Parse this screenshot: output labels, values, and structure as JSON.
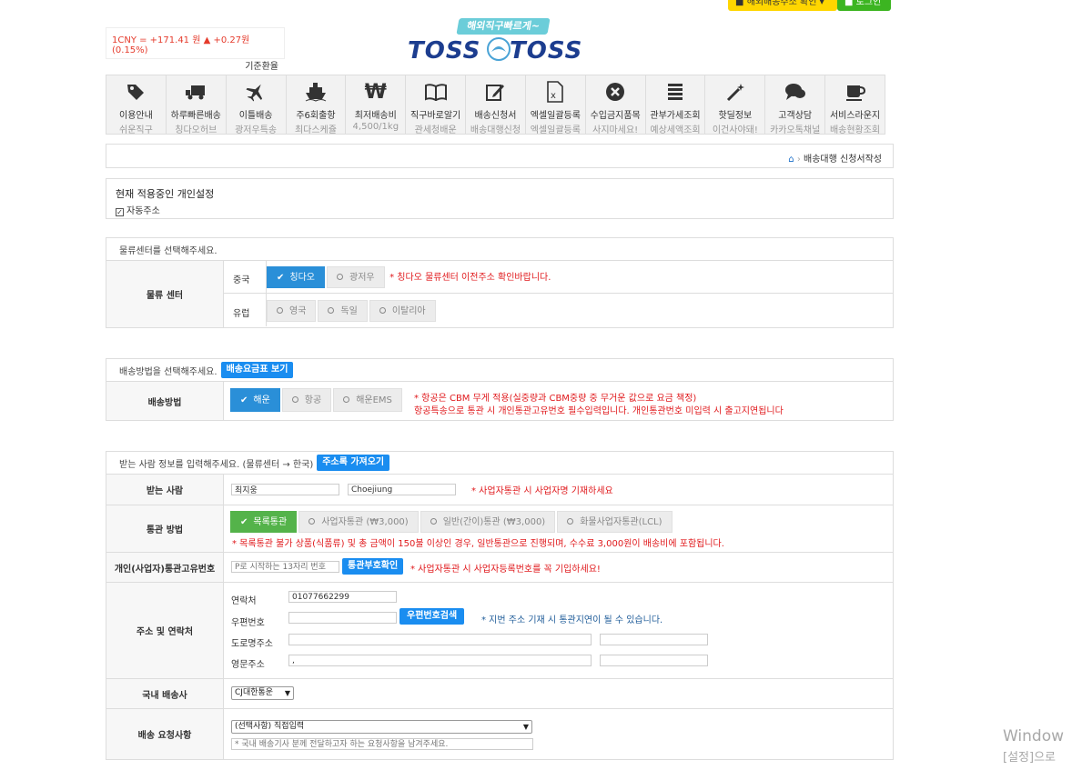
{
  "top_buttons": {
    "customs_check": "■ 해외배송주소 확인 ▾",
    "login": "■ 로그인"
  },
  "currency": {
    "rate": "1CNY = +171.41 원 ▲ +0.27원 (0.15%)",
    "label": "기준환율"
  },
  "logo": {
    "tagline": "해외직구빠르게~",
    "brand": "TOSS TOSS"
  },
  "menu": [
    {
      "icon": "tag-icon",
      "title": "이용안내",
      "sub": "쉬운직구"
    },
    {
      "icon": "truck-icon",
      "title": "하루빠른배송",
      "sub": "칭다오허브"
    },
    {
      "icon": "plane-icon",
      "title": "이틀배송",
      "sub": "광저우특송"
    },
    {
      "icon": "ship-icon",
      "title": "주6회출항",
      "sub": "최다스케쥴"
    },
    {
      "icon": "won-icon",
      "title": "최저배송비",
      "sub": "4,500/1kg"
    },
    {
      "icon": "book-icon",
      "title": "직구바로알기",
      "sub": "관세청배운"
    },
    {
      "icon": "edit-icon",
      "title": "배송신청서",
      "sub": "배송대행신청"
    },
    {
      "icon": "excel-icon",
      "title": "엑셀일괄등록",
      "sub": "엑셀일괄등록"
    },
    {
      "icon": "ban-icon",
      "title": "수입금지품목",
      "sub": "사지마세요!"
    },
    {
      "icon": "list-icon",
      "title": "관부가세조회",
      "sub": "예상세액조회"
    },
    {
      "icon": "magic-icon",
      "title": "핫딜정보",
      "sub": "이건사야돼!"
    },
    {
      "icon": "chat-icon",
      "title": "고객상담",
      "sub": "카카오톡채널"
    },
    {
      "icon": "cup-icon",
      "title": "서비스라운지",
      "sub": "배송현황조회"
    }
  ],
  "breadcrumb": {
    "current": "배송대행 신청서작성"
  },
  "personal": {
    "heading": "현재 적용중인 개인설정",
    "option": "자동주소"
  },
  "center_section": {
    "heading": "물류센터를 선택해주세요.",
    "label": "물류 센터",
    "china_label": "중국",
    "china_options": [
      "칭다오",
      "광저우"
    ],
    "china_note": "* 칭다오 물류센터 이전주소 확인바랍니다.",
    "europe_label": "유럽",
    "europe_options": [
      "영국",
      "독일",
      "이탈리아"
    ]
  },
  "shipping_section": {
    "heading": "배송방법을 선택해주세요.",
    "fee_button": "배송요금표 보기",
    "label": "배송방법",
    "options": [
      "해운",
      "항공",
      "해운EMS"
    ],
    "note1": "* 항공은 CBM 무게 적용(실중량과 CBM중량 중 무거운 값으로 요금 책정)",
    "note2": "항공특송으로 통관 시 개인통관고유번호 필수입력입니다. 개인통관번호 미입력 시 출고지연됩니다"
  },
  "receiver_section": {
    "heading": "받는 사람 정보를 입력해주세요. (물류센터 → 한국)",
    "address_book_button": "주소록 가져오기",
    "receiver_label": "받는 사람",
    "receiver_name": "최지웅",
    "receiver_name_en": "Choejiung",
    "receiver_note": "* 사업자통관 시 사업자명 기재하세요",
    "customs_label": "통관 방법",
    "customs_options": [
      "목록통관",
      "사업자통관 (₩3,000)",
      "일반(간이)통관 (₩3,000)",
      "화물사업자통관(LCL)"
    ],
    "customs_note": "* 목록통관 불가 상품(식품류) 및 총 금액이 150불 이상인 경우, 일반통관으로 진행되며, 수수료 3,000원이 배송비에 포함됩니다.",
    "pccc_label": "개인(사업자)통관고유번호",
    "pccc_placeholder": "P로 시작하는 13자리 번호",
    "pccc_button": "통관부호확인",
    "pccc_note": "* 사업자통관 시 사업자등록번호를 꼭 기입하세요!",
    "address_label": "주소 및 연락처",
    "phone_label": "연락처",
    "phone_value": "01077662299",
    "zip_label": "우편번호",
    "zip_button": "우편번호검색",
    "zip_note": "* 지번 주소 기재 시 통관지연이 될 수 있습니다.",
    "road_label": "도로명주소",
    "eng_label": "영문주소",
    "eng_value": ",",
    "courier_label": "국내 배송사",
    "courier_value": "CJ대한통운",
    "request_label": "배송 요청사항",
    "request_value": "(선택사항) 직접입력",
    "request_placeholder": "* 국내 배송기사 분께 전달하고자 하는 요청사항을 남겨주세요."
  },
  "watermark": {
    "line1": "Window",
    "line2": "[설정]으로"
  }
}
